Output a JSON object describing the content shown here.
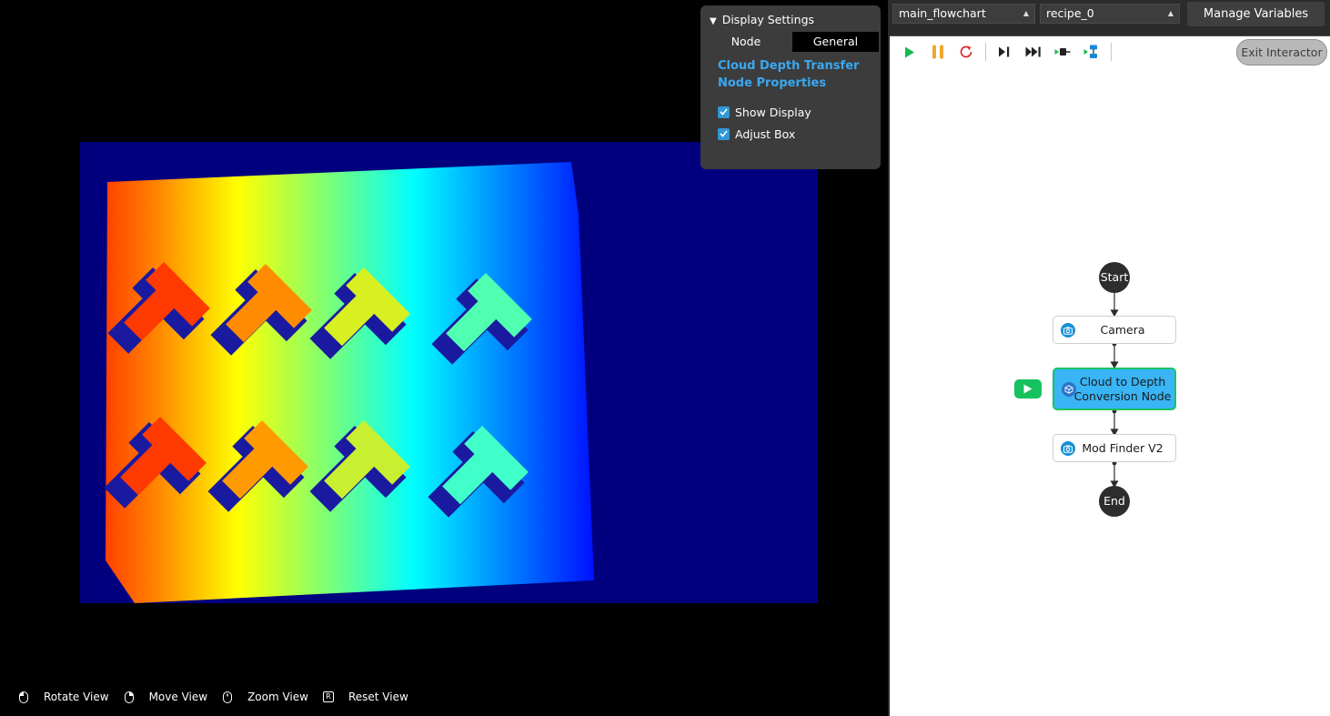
{
  "display_settings": {
    "header": "Display Settings",
    "tabs": [
      "Node",
      "General"
    ],
    "active_tab": "General",
    "section_title": "Cloud Depth Transfer Node Properties",
    "options": [
      {
        "label": "Show Display",
        "checked": true
      },
      {
        "label": "Adjust Box",
        "checked": true
      }
    ]
  },
  "view_controls": [
    {
      "label": "Rotate View",
      "icon": "mouse-left-icon"
    },
    {
      "label": "Move View",
      "icon": "mouse-right-icon"
    },
    {
      "label": "Zoom View",
      "icon": "mouse-wheel-icon"
    },
    {
      "label": "Reset View",
      "icon": "r-key-icon",
      "key": "R"
    }
  ],
  "top_bar": {
    "flowchart": "main_flowchart",
    "recipe": "recipe_0",
    "manage_variables": "Manage Variables"
  },
  "toolbar": {
    "exit_interactor": "Exit Interactor",
    "buttons": [
      "play-icon",
      "pause-icon",
      "restart-icon",
      "step-icon",
      "step-all-icon",
      "breakpoint-icon",
      "flow-layout-icon"
    ]
  },
  "flowchart": {
    "start": "Start",
    "end": "End",
    "nodes": [
      {
        "label": "Camera",
        "icon": "camera-icon",
        "active": false
      },
      {
        "label": "Cloud to Depth Conversion Node",
        "label_lines": [
          "Cloud to Depth",
          "Conversion Node"
        ],
        "icon": "cube-icon",
        "active": true
      },
      {
        "label": "Mod Finder V2",
        "icon": "camera-icon",
        "active": false
      }
    ]
  },
  "colors": {
    "accent_blue": "#3aa8f0",
    "active_node": "#39b4f4",
    "active_border": "#19c365",
    "depth_background": "#00007e",
    "exit_button": "#b9b9b9"
  }
}
